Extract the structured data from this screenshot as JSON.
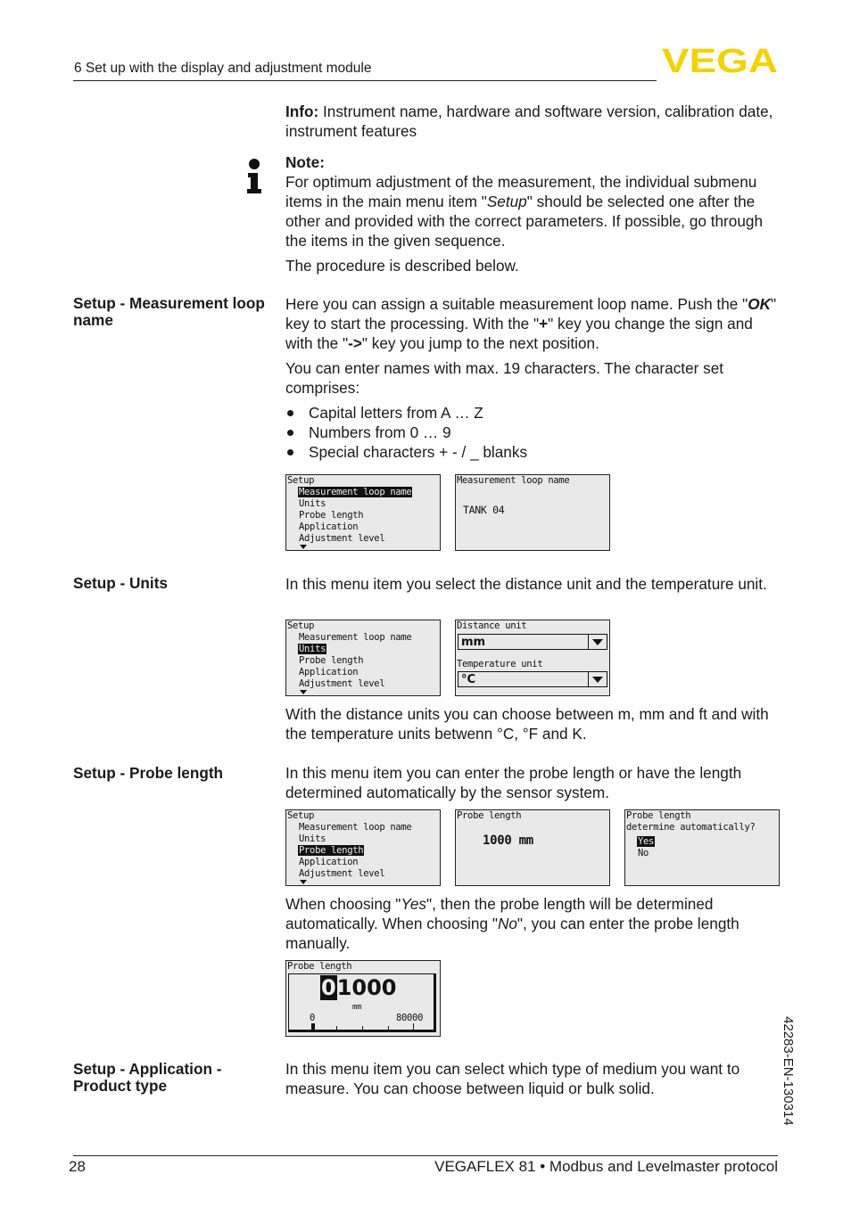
{
  "header": {
    "section_title": "6 Set up with the display and adjustment module",
    "logo_text": "VEGA",
    "brand_color": "#f2d200"
  },
  "info": {
    "label": "Info:",
    "text": " Instrument name, hardware and software version, calibration date, instrument features"
  },
  "note": {
    "icon": "info-icon",
    "title": "Note:",
    "text_before": "For optimum adjustment of the measurement, the individual submenu items in the main menu item \"",
    "text_em": "Setup",
    "text_after": "\" should be selected one after the other and provided with the correct parameters. If possible, go through the items in the given sequence.",
    "procedure": "The procedure is described below."
  },
  "sections": {
    "loop_name": {
      "heading": "Setup - Measurement loop name",
      "p1_a": "Here you can assign a suitable measurement loop name. Push the \"",
      "p1_ok": "OK",
      "p1_b": "\" key to start the processing. With the \"",
      "p1_plus": "+",
      "p1_c": "\" key you change the sign and with the \"",
      "p1_arrow": "->",
      "p1_d": "\" key you jump to the next position.",
      "p2": "You can enter names with max. 19 characters. The character set comprises:",
      "bullets": [
        "Capital letters from A … Z",
        "Numbers from 0 … 9",
        "Special characters + - / _ blanks"
      ],
      "screen2_title": "Measurement loop name",
      "screen2_value": "TANK 04"
    },
    "units": {
      "heading": "Setup - Units",
      "p1": "In this menu item you select the distance unit and the temperature unit.",
      "distance_label": "Distance unit",
      "distance_value": "mm",
      "temperature_label": "Temperature unit",
      "temperature_value": "°C",
      "p2": "With the distance units you can choose between m, mm and ft and with the temperature units betwenn °C, °F and K."
    },
    "probe": {
      "heading": "Setup - Probe length",
      "p1": "In this menu item you can enter the probe length or have the length determined automatically by the sensor system.",
      "screen2_title": "Probe length",
      "screen2_value": "1000 mm",
      "screen3_title": "Probe length",
      "screen3_question": "determine automatically?",
      "screen3_yes": "Yes",
      "screen3_no": "No",
      "p2_a": "When choosing \"",
      "p2_yes": "Yes",
      "p2_b": "\", then the probe length will be determined automatically. When choosing \"",
      "p2_no": "No",
      "p2_c": "\", you can enter the probe length manually.",
      "edit_title": "Probe length",
      "edit_cursor_digit": "0",
      "edit_value": "1000",
      "edit_unit": "mm",
      "edit_min": "0",
      "edit_max": "80000",
      "edit_fraction": 0.0125
    },
    "application": {
      "heading": "Setup - Application - Product type",
      "p1": "In this menu item you can select which type of medium you want to measure. You can choose between liquid or bulk solid."
    }
  },
  "setup_menu": {
    "title": "Setup",
    "items": [
      "Measurement loop name",
      "Units",
      "Probe length",
      "Application",
      "Adjustment level"
    ]
  },
  "footer": {
    "page_number": "28",
    "doc_title": "VEGAFLEX 81 • Modbus and Levelmaster protocol",
    "doc_id": "42283-EN-130314"
  }
}
